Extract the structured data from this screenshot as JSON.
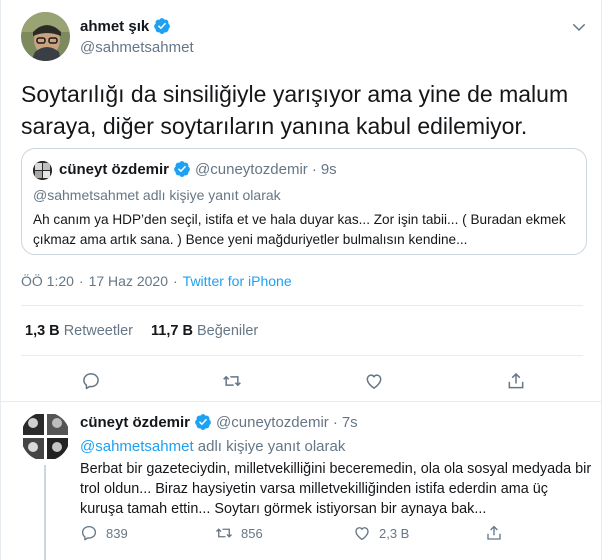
{
  "main_tweet": {
    "author_name": "ahmet şık",
    "author_handle": "@sahmetsahmet",
    "text": "Soytarılığı da sinsiliğiyle yarışıyor ama yine de malum saraya, diğer soytarıların yanına kabul edilemiyor.",
    "quote": {
      "author_name": "cüneyt özdemir",
      "author_handle": "@cuneytozdemir",
      "separator": "·",
      "time": "9s",
      "reply_context": "@sahmetsahmet adlı kişiye yanıt olarak",
      "text": "Ah canım ya HDP’den seçil, istifa et ve hala duyar kas... Zor işin tabii... ( Buradan ekmek çıkmaz ama artık sana. ) Bence yeni mağduriyetler bulmalısın kendine..."
    },
    "timestamp": "ÖÖ 1:20",
    "dot": "·",
    "date": "17 Haz 2020",
    "source": "Twitter for iPhone",
    "stats": {
      "retweets_count": "1,3 B",
      "retweets_label": "Retweetler",
      "likes_count": "11,7 B",
      "likes_label": "Beğeniler"
    },
    "actions": [
      "reply-icon",
      "retweet-icon",
      "like-icon",
      "share-icon"
    ]
  },
  "reply_tweet": {
    "author_name": "cüneyt özdemir",
    "author_handle": "@cuneytozdemir",
    "separator": "·",
    "time": "7s",
    "reply_mention": "@sahmetsahmet",
    "reply_suffix": " adlı kişiye yanıt olarak",
    "text": "Berbat bir gazeteciydin, milletvekilliğini beceremedin, ola ola sosyal medyada bir trol oldun... Biraz haysiyetin varsa milletvekilliğinden istifa ederdin ama üç kuruşa tamah ettin... Soytarı görmek istiyorsan bir aynaya bak...",
    "replies": "839",
    "retweets": "856",
    "likes": "2,3 B"
  },
  "colors": {
    "accent": "#1da1f2",
    "text": "#14171a",
    "secondary": "#657786",
    "border": "#e6ecf0"
  }
}
